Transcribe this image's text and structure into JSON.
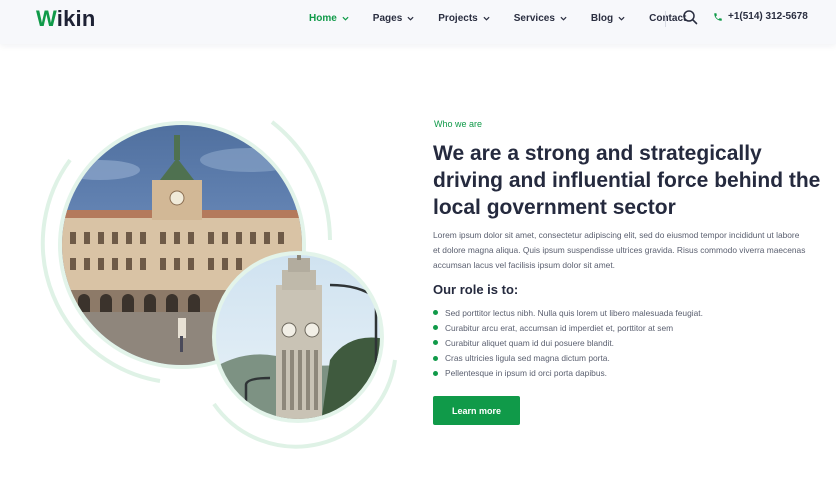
{
  "brand": {
    "first_letter": "W",
    "rest": "ikin",
    "accent_color": "#109a49"
  },
  "nav": {
    "items": [
      {
        "label": "Home",
        "has_dropdown": true,
        "active": true
      },
      {
        "label": "Pages",
        "has_dropdown": true
      },
      {
        "label": "Projects",
        "has_dropdown": true
      },
      {
        "label": "Services",
        "has_dropdown": true
      },
      {
        "label": "Blog",
        "has_dropdown": true
      },
      {
        "label": "Contact",
        "has_dropdown": false
      }
    ],
    "search_icon": "search-icon",
    "phone": "+1(514) 312-5678"
  },
  "about": {
    "eyebrow": "Who we are",
    "title": "We are a strong and strategically driving and influential force behind the local government sector",
    "lead": "Lorem ipsum dolor sit amet, consectetur adipiscing elit, sed do eiusmod tempor incididunt ut labore et dolore magna aliqua. Quis ipsum suspendisse ultrices gravida. Risus commodo viverra maecenas accumsan lacus vel facilisis ipsum dolor sit amet.",
    "role_title": "Our role is to:",
    "roles": [
      "Sed porttitor lectus nibh. Nulla quis lorem ut libero malesuada feugiat.",
      "Curabitur arcu erat, accumsan id imperdiet et, porttitor at sem",
      "Curabitur aliquet quam id dui posuere blandit.",
      "Cras ultricies ligula sed magna dictum porta.",
      "Pellentesque in ipsum id orci porta dapibus."
    ],
    "cta": "Learn more"
  }
}
